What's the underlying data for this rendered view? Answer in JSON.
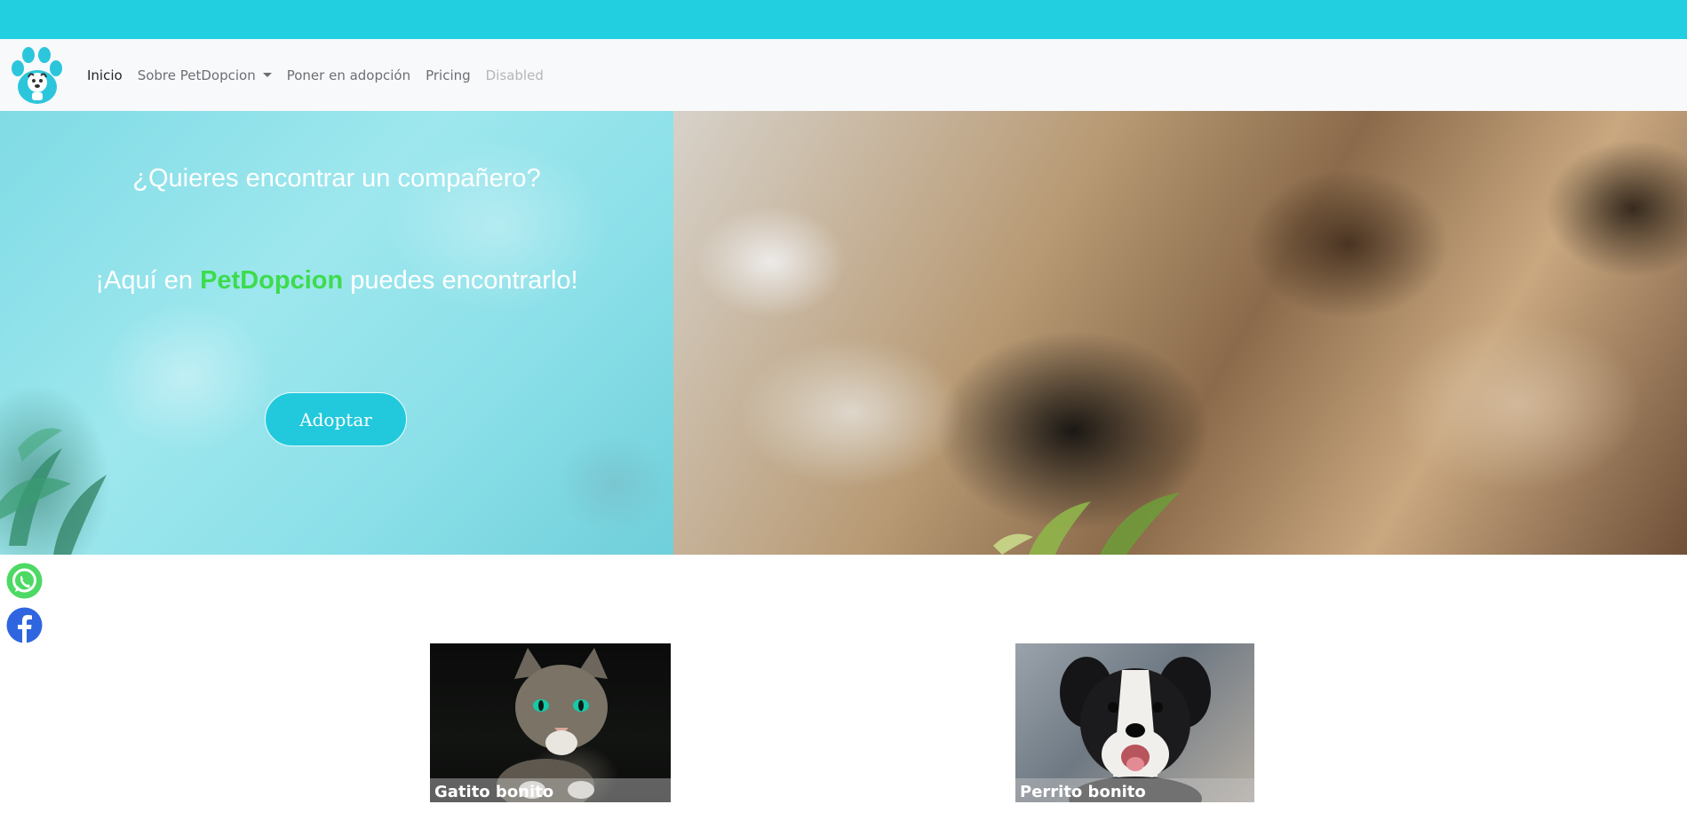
{
  "navbar": {
    "items": [
      {
        "label": "Inicio",
        "state": "active"
      },
      {
        "label": "Sobre PetDopcion",
        "state": "dropdown"
      },
      {
        "label": "Poner en adopción",
        "state": "normal"
      },
      {
        "label": "Pricing",
        "state": "normal"
      },
      {
        "label": "Disabled",
        "state": "disabled"
      }
    ]
  },
  "hero": {
    "question": "¿Quieres encontrar un compañero?",
    "line_prefix": "¡Aquí en ",
    "line_brand": "PetDopcion",
    "line_suffix": " puedes encontrarlo!",
    "cta_label": "Adoptar"
  },
  "social": {
    "icons": [
      "whatsapp-icon",
      "facebook-icon"
    ]
  },
  "cards": [
    {
      "caption": "Gatito bonito"
    },
    {
      "caption": "Perrito bonito"
    }
  ],
  "colors": {
    "accent": "#22cfe0",
    "brand_highlight": "#3ddb4d",
    "navbar_bg": "#f8f9fb"
  }
}
